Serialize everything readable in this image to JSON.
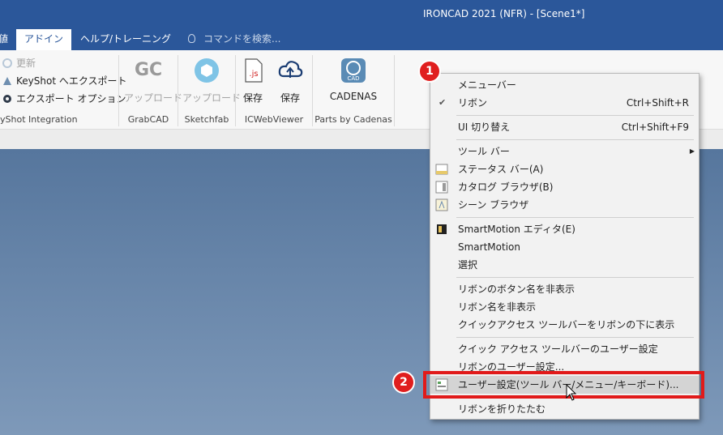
{
  "window": {
    "title": "IRONCAD 2021 (NFR) - [Scene1*]"
  },
  "tabs": {
    "partial_left": "値",
    "addin": "アドイン",
    "help": "ヘルプ/トレーニング"
  },
  "search": {
    "placeholder": "コマンドを検索..."
  },
  "ribbon": {
    "keyshot": {
      "update": "更新",
      "export": "KeyShot へエクスポート",
      "export_options": "エクスポート オプション",
      "label": "yShot Integration"
    },
    "grabcad": {
      "logo": "GC",
      "upload": "アップロード",
      "label": "GrabCAD"
    },
    "sketchfab": {
      "upload": "アップロード",
      "label": "Sketchfab"
    },
    "icwebviewer": {
      "js_badge": ".js",
      "save1": "保存",
      "save2": "保存",
      "label": "ICWebViewer"
    },
    "cadenas": {
      "logo": "CAD",
      "name": "CADENAS",
      "label": "Parts by Cadenas"
    }
  },
  "menu": {
    "menubar": "メニューバー",
    "ribbon": "リボン",
    "ribbon_shortcut": "Ctrl+Shift+R",
    "ui_switch": "UI 切り替え",
    "ui_switch_shortcut": "Ctrl+Shift+F9",
    "toolbar": "ツール バー",
    "statusbar": "ステータス バー(A)",
    "catalog_browser": "カタログ ブラウザ(B)",
    "scene_browser": "シーン ブラウザ",
    "smartmotion_editor": "SmartMotion エディタ(E)",
    "smartmotion": "SmartMotion",
    "select": "選択",
    "hide_button_names": "リボンのボタン名を非表示",
    "hide_ribbon_names": "リボン名を非表示",
    "qat_below": "クイックアクセス ツールバーをリボンの下に表示",
    "qat_customize": "クイック アクセス ツールバーのユーザー設定",
    "ribbon_customize": "リボンのユーザー設定...",
    "user_settings": "ユーザー設定(ツール バー/メニュー/キーボード)...",
    "collapse_ribbon": "リボンを折りたたむ"
  },
  "annotations": {
    "badge1": "1",
    "badge2": "2"
  },
  "colors": {
    "titlebar": "#2b579a",
    "highlight_box": "#e11a1a",
    "badge": "#e01e1e"
  }
}
